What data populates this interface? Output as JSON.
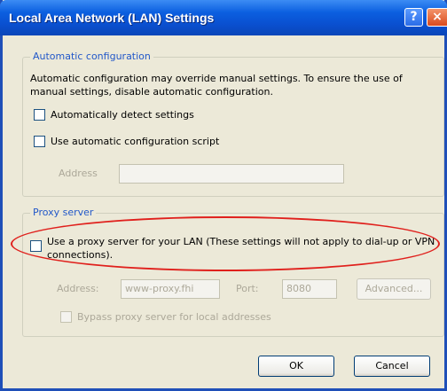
{
  "window": {
    "title": "Local Area Network (LAN) Settings",
    "help_glyph": "?",
    "close_glyph": "×"
  },
  "auto_config": {
    "legend": "Automatic configuration",
    "description": "Automatic configuration may override manual settings.  To ensure the use of manual settings, disable automatic configuration.",
    "detect_label": "Automatically detect settings",
    "script_label": "Use automatic configuration script",
    "address_label": "Address",
    "address_value": ""
  },
  "proxy": {
    "legend": "Proxy server",
    "use_proxy_label": "Use a proxy server for your LAN (These settings will not apply to dial-up or VPN connections).",
    "address_label": "Address:",
    "address_value": "www-proxy.fhi",
    "port_label": "Port:",
    "port_value": "8080",
    "advanced_label": "Advanced...",
    "bypass_label": "Bypass proxy server for local addresses"
  },
  "buttons": {
    "ok": "OK",
    "cancel": "Cancel"
  },
  "colors": {
    "title_bar": "#0a4fcf",
    "legend_text": "#2258c9",
    "highlight_ellipse": "#e0201c"
  }
}
